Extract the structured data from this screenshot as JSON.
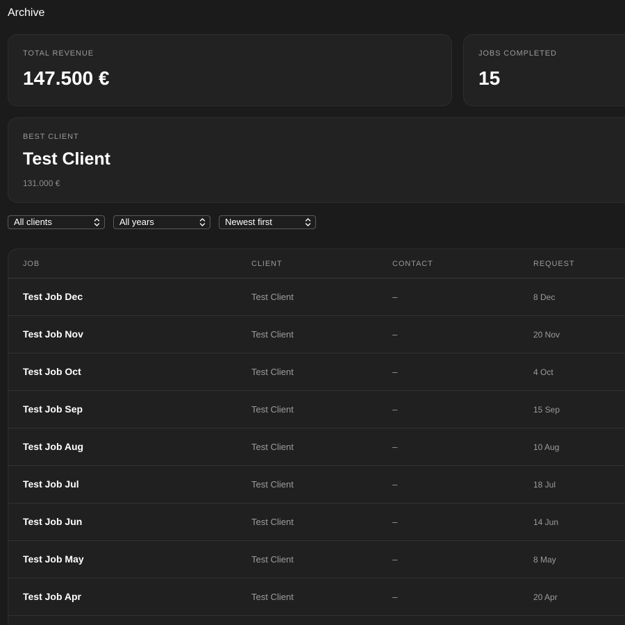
{
  "page": {
    "title": "Archive"
  },
  "stats": {
    "revenue": {
      "label": "TOTAL REVENUE",
      "value": "147.500 €"
    },
    "jobs": {
      "label": "JOBS COMPLETED",
      "value": "15"
    },
    "best_client": {
      "label": "BEST CLIENT",
      "value": "Test Client",
      "sub": "131.000 €"
    }
  },
  "filters": {
    "client": "All clients",
    "year": "All years",
    "sort": "Newest first"
  },
  "table": {
    "headers": [
      "JOB",
      "CLIENT",
      "CONTACT",
      "REQUEST"
    ],
    "rows": [
      {
        "job": "Test Job Dec",
        "client": "Test Client",
        "contact": "–",
        "request": "8 Dec"
      },
      {
        "job": "Test Job Nov",
        "client": "Test Client",
        "contact": "–",
        "request": "20 Nov"
      },
      {
        "job": "Test Job Oct",
        "client": "Test Client",
        "contact": "–",
        "request": "4 Oct"
      },
      {
        "job": "Test Job Sep",
        "client": "Test Client",
        "contact": "–",
        "request": "15 Sep"
      },
      {
        "job": "Test Job Aug",
        "client": "Test Client",
        "contact": "–",
        "request": "10 Aug"
      },
      {
        "job": "Test Job Jul",
        "client": "Test Client",
        "contact": "–",
        "request": "18 Jul"
      },
      {
        "job": "Test Job Jun",
        "client": "Test Client",
        "contact": "–",
        "request": "14 Jun"
      },
      {
        "job": "Test Job May",
        "client": "Test Client",
        "contact": "–",
        "request": "8 May"
      },
      {
        "job": "Test Job Apr",
        "client": "Test Client",
        "contact": "–",
        "request": "20 Apr"
      }
    ]
  },
  "colors": {
    "background": "#1b1b1b",
    "card": "#222222",
    "muted_text": "#9a9a9a"
  },
  "icons": {
    "select_chevron": "chevron-up-down-icon"
  }
}
